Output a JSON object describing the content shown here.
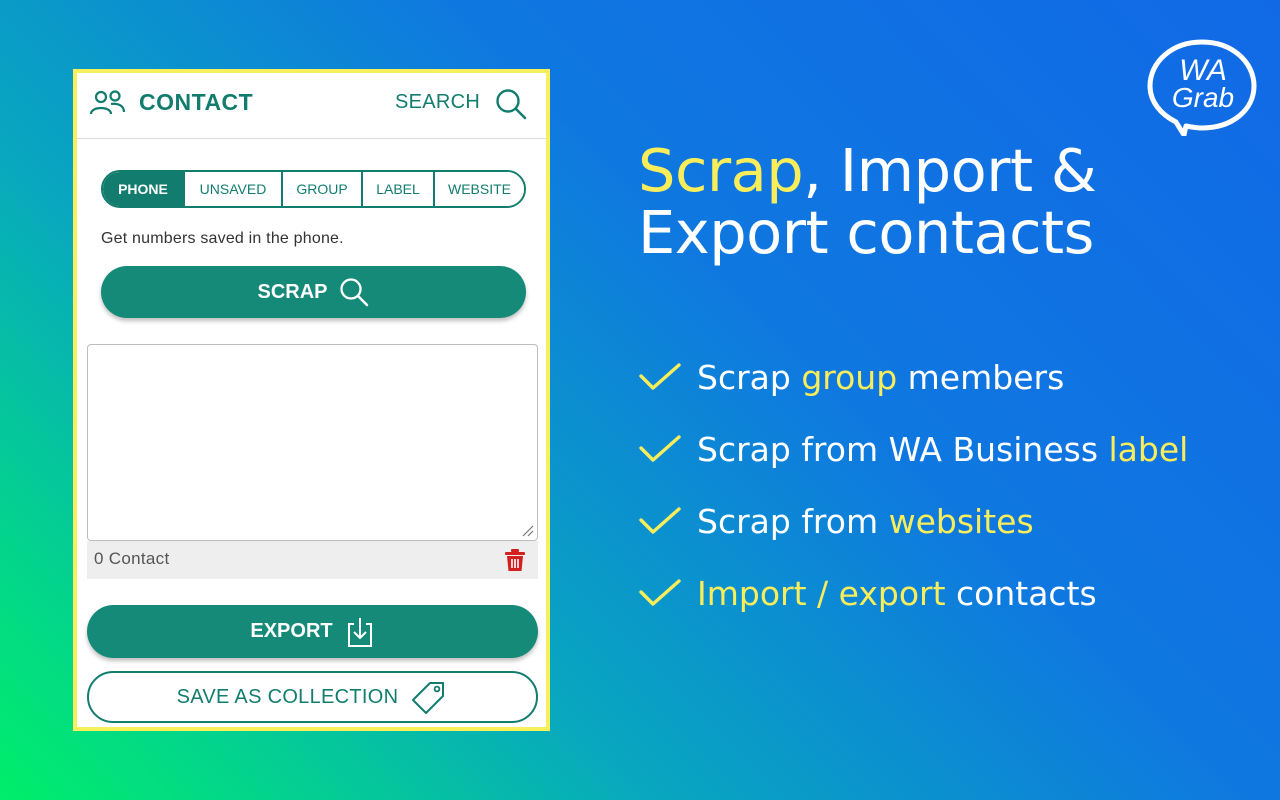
{
  "panel": {
    "title": "CONTACT",
    "search_label": "SEARCH",
    "tabs": [
      {
        "label": "PHONE",
        "active": true
      },
      {
        "label": "UNSAVED",
        "active": false
      },
      {
        "label": "GROUP",
        "active": false
      },
      {
        "label": "LABEL",
        "active": false
      },
      {
        "label": "WEBSITE",
        "active": false
      }
    ],
    "hint": "Get numbers saved in the phone.",
    "scrap_label": "SCRAP",
    "textarea_value": "",
    "contact_count": "0 Contact",
    "export_label": "EXPORT",
    "save_collection_label": "SAVE AS COLLECTION"
  },
  "logo": {
    "line1": "WA",
    "line2": "Grab"
  },
  "headline": {
    "highlight": "Scrap",
    "rest1": ", Import &",
    "line2": "Export contacts"
  },
  "features": [
    {
      "pre": "Scrap ",
      "hl": "group",
      "post": " members"
    },
    {
      "pre": "Scrap from WA Business ",
      "hl": "label",
      "post": ""
    },
    {
      "pre": "Scrap from ",
      "hl": "websites",
      "post": ""
    },
    {
      "pre": "",
      "hl": "Import / export",
      "post": " contacts"
    }
  ],
  "colors": {
    "brand": "#127d6e",
    "button": "#168a78",
    "highlight": "#f9ee5a",
    "panel_border": "#f7f05a",
    "trash": "#d21f1f"
  }
}
